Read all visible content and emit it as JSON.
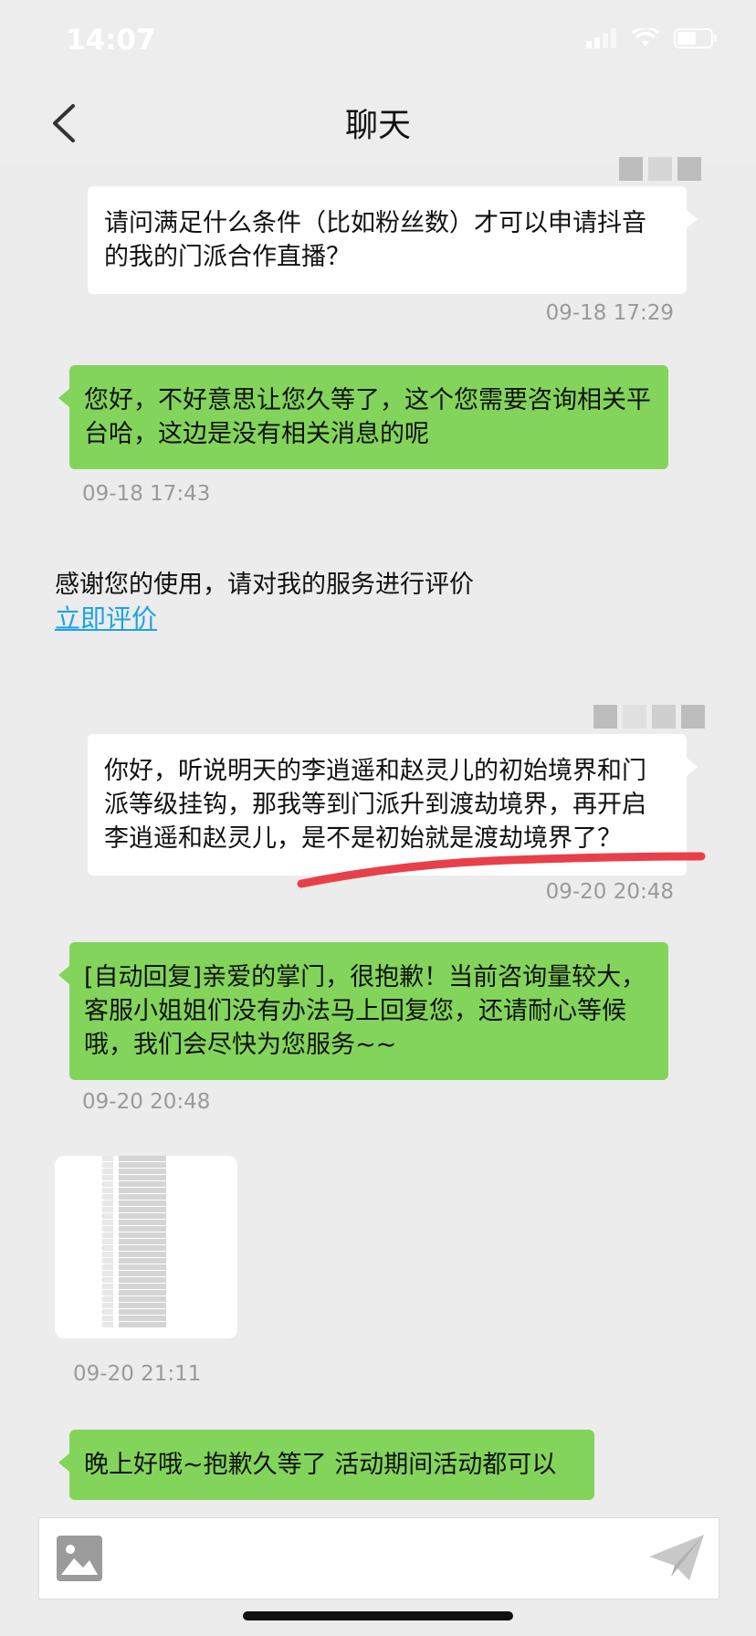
{
  "status_bar": {
    "time": "14:07"
  },
  "header": {
    "title": "聊天"
  },
  "messages": [
    {
      "side": "right",
      "text": "请问满足什么条件（比如粉丝数）才可以申请抖音的我的门派合作直播？",
      "time": "09-18 17:29"
    },
    {
      "side": "left",
      "text": "您好，不好意思让您久等了，这个您需要咨询相关平台哈，这边是没有相关消息的呢",
      "time": "09-18 17:43"
    },
    {
      "side": "right",
      "text": "你好，听说明天的李逍遥和赵灵儿的初始境界和门派等级挂钩，那我等到门派升到渡劫境界，再开启李逍遥和赵灵儿，是不是初始就是渡劫境界了？",
      "time": "09-20 20:48"
    },
    {
      "side": "left",
      "text": "[自动回复]亲爱的掌门，很抱歉！当前咨询量较大，客服小姐姐们没有办法马上回复您，还请耐心等候哦，我们会尽快为您服务~~",
      "time": "09-20 20:48"
    },
    {
      "side": "left",
      "text": "晚上好哦~抱歉久等了 活动期间活动都可以"
    }
  ],
  "evaluation": {
    "prompt": "感谢您的使用，请对我的服务进行评价",
    "link": "立即评价"
  },
  "image_message": {
    "time": "09-20 21:11"
  },
  "colors": {
    "green_bubble": "#83d45b",
    "link": "#1aa3e8",
    "annotation": "#e8404a"
  },
  "icons": [
    "back-chevron-icon",
    "signal-icon",
    "wifi-icon",
    "battery-icon",
    "image-icon",
    "send-icon"
  ]
}
